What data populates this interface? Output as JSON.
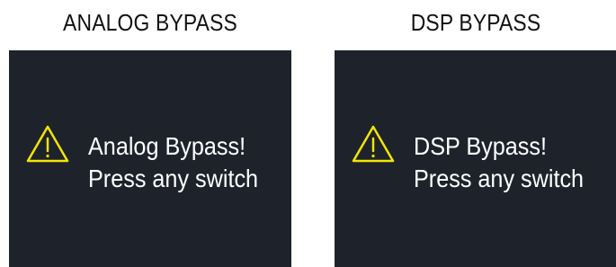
{
  "panels": [
    {
      "title": "ANALOG BYPASS",
      "message_line1": "Analog Bypass!",
      "message_line2": "Press any switch",
      "icon": "warning-triangle-icon"
    },
    {
      "title": "DSP BYPASS",
      "message_line1": "DSP Bypass!",
      "message_line2": "Press any switch",
      "icon": "warning-triangle-icon"
    }
  ],
  "colors": {
    "screen_bg": "#1e232b",
    "warning_yellow": "#f2e600",
    "text_white": "#ffffff",
    "title_black": "#111111"
  }
}
